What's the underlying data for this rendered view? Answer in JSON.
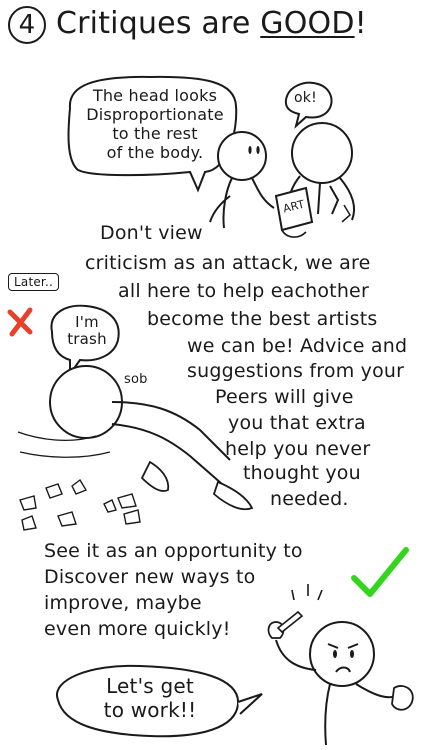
{
  "header": {
    "number": "4",
    "title_prefix": "Critiques are ",
    "title_emphasis": "GOOD",
    "title_suffix": "!"
  },
  "panel1": {
    "bubble_lines": [
      "The head looks",
      "Disproportionate",
      "to the rest",
      "of the body."
    ],
    "reply": "ok!",
    "paper_label": "ART"
  },
  "panel2": {
    "lines": [
      "Don't view",
      "criticism as an attack, we are",
      "all here to help eachother",
      "become the best artists",
      "we can be! Advice and",
      "suggestions from your",
      "Peers will give",
      "you that extra",
      "help you never",
      "thought you",
      "needed."
    ],
    "later_tag": "Later..",
    "bubble": [
      "I'm",
      "trash"
    ],
    "sob": "sob",
    "x_color": "#e8402a"
  },
  "panel3": {
    "lines": [
      "See it as an opportunity to",
      "Discover new ways to",
      "improve, maybe",
      "even more quickly!"
    ],
    "bubble": [
      "Let's get",
      "to work!!"
    ],
    "check_color": "#33d61c"
  }
}
